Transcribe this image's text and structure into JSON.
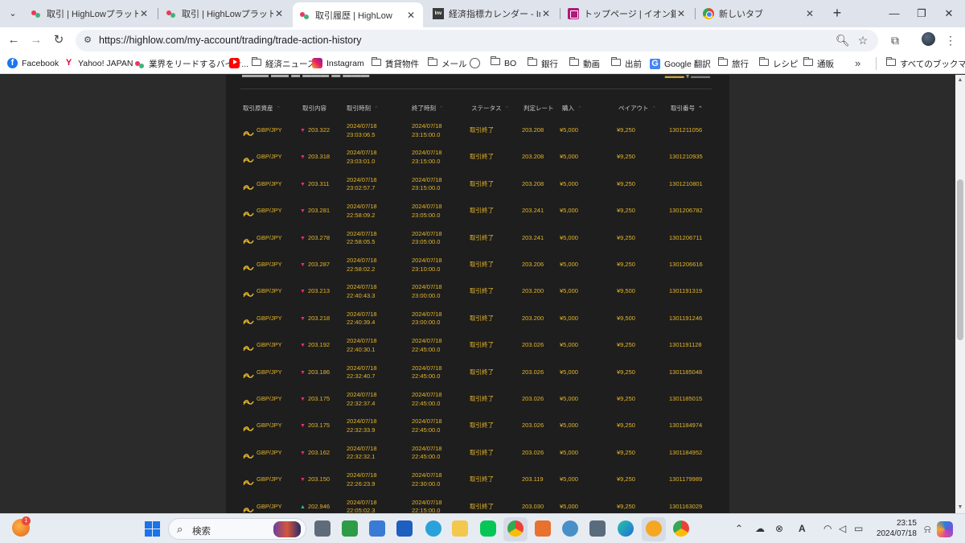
{
  "browser": {
    "tabs": [
      {
        "title": "取引 | HighLowプラットフォーム",
        "favicon": "highlow-icon",
        "active": false
      },
      {
        "title": "取引 | HighLowプラットフォーム",
        "favicon": "highlow-icon",
        "active": false
      },
      {
        "title": "取引履歴 | HighLow",
        "favicon": "highlow-icon",
        "active": true
      },
      {
        "title": "経済指標カレンダー - Investing",
        "favicon": "investing-icon",
        "active": false
      },
      {
        "title": "トップページ | イオン銀行ダイレクト",
        "favicon": "aeon-icon",
        "active": false
      },
      {
        "title": "新しいタブ",
        "favicon": "chrome-icon",
        "active": false
      }
    ],
    "investing_favicon_text": "Inv",
    "url": "https://highlow.com/my-account/trading/trade-action-history",
    "bookmarks": [
      {
        "label": "Facebook",
        "icon": "facebook-icon"
      },
      {
        "label": "Yahoo! JAPAN",
        "icon": "yahoo-icon"
      },
      {
        "label": "業界をリードするバイナ...",
        "icon": "highlow-icon"
      },
      {
        "label": "",
        "icon": "youtube-icon"
      },
      {
        "label": "経済ニュース",
        "icon": "folder-icon"
      },
      {
        "label": "Instagram",
        "icon": "instagram-icon"
      },
      {
        "label": "賃貸物件",
        "icon": "folder-icon"
      },
      {
        "label": "メール",
        "icon": "folder-icon"
      },
      {
        "label": "",
        "icon": "globe-icon"
      },
      {
        "label": "BO",
        "icon": "folder-icon"
      },
      {
        "label": "銀行",
        "icon": "folder-icon"
      },
      {
        "label": "動画",
        "icon": "folder-icon"
      },
      {
        "label": "出前",
        "icon": "folder-icon"
      },
      {
        "label": "Google 翻訳",
        "icon": "google-translate-icon"
      },
      {
        "label": "旅行",
        "icon": "folder-icon"
      },
      {
        "label": "レシピ",
        "icon": "folder-icon"
      },
      {
        "label": "通販",
        "icon": "folder-icon"
      }
    ],
    "all_bookmarks": "すべてのブックマーク"
  },
  "trade_history": {
    "columns": [
      "取引原資産",
      "取引内容",
      "取引時刻",
      "終了時刻",
      "ステータス",
      "判定レート",
      "購入",
      "ペイアウト",
      "取引番号"
    ],
    "rows": [
      {
        "asset": "GBP/JPY",
        "direction": "down",
        "rate": "203.322",
        "trade_date": "2024/07/18",
        "trade_time": "23:03:06.5",
        "end_date": "2024/07/18",
        "end_time": "23:15:00.0",
        "status": "取引終了",
        "judge_rate": "203.208",
        "purchase": "¥5,000",
        "payout": "¥9,250",
        "trade_no": "1301211056"
      },
      {
        "asset": "GBP/JPY",
        "direction": "down",
        "rate": "203.318",
        "trade_date": "2024/07/18",
        "trade_time": "23:03:01.0",
        "end_date": "2024/07/18",
        "end_time": "23:15:00.0",
        "status": "取引終了",
        "judge_rate": "203.208",
        "purchase": "¥5,000",
        "payout": "¥9,250",
        "trade_no": "1301210935"
      },
      {
        "asset": "GBP/JPY",
        "direction": "down",
        "rate": "203.311",
        "trade_date": "2024/07/18",
        "trade_time": "23:02:57.7",
        "end_date": "2024/07/18",
        "end_time": "23:15:00.0",
        "status": "取引終了",
        "judge_rate": "203.208",
        "purchase": "¥5,000",
        "payout": "¥9,250",
        "trade_no": "1301210801"
      },
      {
        "asset": "GBP/JPY",
        "direction": "down",
        "rate": "203.281",
        "trade_date": "2024/07/18",
        "trade_time": "22:58:09.2",
        "end_date": "2024/07/18",
        "end_time": "23:05:00.0",
        "status": "取引終了",
        "judge_rate": "203.241",
        "purchase": "¥5,000",
        "payout": "¥9,250",
        "trade_no": "1301206782"
      },
      {
        "asset": "GBP/JPY",
        "direction": "down",
        "rate": "203.278",
        "trade_date": "2024/07/18",
        "trade_time": "22:58:05.5",
        "end_date": "2024/07/18",
        "end_time": "23:05:00.0",
        "status": "取引終了",
        "judge_rate": "203.241",
        "purchase": "¥5,000",
        "payout": "¥9,250",
        "trade_no": "1301206711"
      },
      {
        "asset": "GBP/JPY",
        "direction": "down",
        "rate": "203.287",
        "trade_date": "2024/07/18",
        "trade_time": "22:58:02.2",
        "end_date": "2024/07/18",
        "end_time": "23:10:00.0",
        "status": "取引終了",
        "judge_rate": "203.206",
        "purchase": "¥5,000",
        "payout": "¥9,250",
        "trade_no": "1301206616"
      },
      {
        "asset": "GBP/JPY",
        "direction": "down",
        "rate": "203.213",
        "trade_date": "2024/07/18",
        "trade_time": "22:40:43.3",
        "end_date": "2024/07/18",
        "end_time": "23:00:00.0",
        "status": "取引終了",
        "judge_rate": "203.200",
        "purchase": "¥5,000",
        "payout": "¥9,500",
        "trade_no": "1301191319"
      },
      {
        "asset": "GBP/JPY",
        "direction": "down",
        "rate": "203.218",
        "trade_date": "2024/07/18",
        "trade_time": "22:40:39.4",
        "end_date": "2024/07/18",
        "end_time": "23:00:00.0",
        "status": "取引終了",
        "judge_rate": "203.200",
        "purchase": "¥5,000",
        "payout": "¥9,500",
        "trade_no": "1301191246"
      },
      {
        "asset": "GBP/JPY",
        "direction": "down",
        "rate": "203.192",
        "trade_date": "2024/07/18",
        "trade_time": "22:40:30.1",
        "end_date": "2024/07/18",
        "end_time": "22:45:00.0",
        "status": "取引終了",
        "judge_rate": "203.026",
        "purchase": "¥5,000",
        "payout": "¥9,250",
        "trade_no": "1301191128"
      },
      {
        "asset": "GBP/JPY",
        "direction": "down",
        "rate": "203.186",
        "trade_date": "2024/07/18",
        "trade_time": "22:32:40.7",
        "end_date": "2024/07/18",
        "end_time": "22:45:00.0",
        "status": "取引終了",
        "judge_rate": "203.026",
        "purchase": "¥5,000",
        "payout": "¥9,250",
        "trade_no": "1301185048"
      },
      {
        "asset": "GBP/JPY",
        "direction": "down",
        "rate": "203.175",
        "trade_date": "2024/07/18",
        "trade_time": "22:32:37.4",
        "end_date": "2024/07/18",
        "end_time": "22:45:00.0",
        "status": "取引終了",
        "judge_rate": "203.026",
        "purchase": "¥5,000",
        "payout": "¥9,250",
        "trade_no": "1301185015"
      },
      {
        "asset": "GBP/JPY",
        "direction": "down",
        "rate": "203.175",
        "trade_date": "2024/07/18",
        "trade_time": "22:32:33.9",
        "end_date": "2024/07/18",
        "end_time": "22:45:00.0",
        "status": "取引終了",
        "judge_rate": "203.026",
        "purchase": "¥5,000",
        "payout": "¥9,250",
        "trade_no": "1301184974"
      },
      {
        "asset": "GBP/JPY",
        "direction": "down",
        "rate": "203.162",
        "trade_date": "2024/07/18",
        "trade_time": "22:32:32.1",
        "end_date": "2024/07/18",
        "end_time": "22:45:00.0",
        "status": "取引終了",
        "judge_rate": "203.026",
        "purchase": "¥5,000",
        "payout": "¥9,250",
        "trade_no": "1301184952"
      },
      {
        "asset": "GBP/JPY",
        "direction": "down",
        "rate": "203.150",
        "trade_date": "2024/07/18",
        "trade_time": "22:26:23.9",
        "end_date": "2024/07/18",
        "end_time": "22:30:00.0",
        "status": "取引終了",
        "judge_rate": "203.119",
        "purchase": "¥5,000",
        "payout": "¥9,250",
        "trade_no": "1301179989"
      },
      {
        "asset": "GBP/JPY",
        "direction": "up",
        "rate": "202.946",
        "trade_date": "2024/07/18",
        "trade_time": "22:05:02.3",
        "end_date": "2024/07/18",
        "end_time": "22:15:00.0",
        "status": "取引終了",
        "judge_rate": "203.030",
        "purchase": "¥5,000",
        "payout": "¥9,250",
        "trade_no": "1301163029"
      }
    ]
  },
  "taskbar": {
    "search_placeholder": "検索",
    "widget_badge": "1",
    "time": "23:15",
    "date": "2024/07/18"
  },
  "colors": {
    "accent_gold": "#e4b52a",
    "down_red": "#e8336b",
    "up_green": "#2ec27e"
  }
}
